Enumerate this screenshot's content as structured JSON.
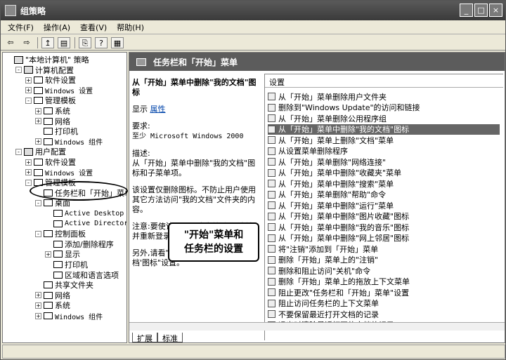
{
  "window": {
    "title": "组策略",
    "buttons": [
      "_",
      "□",
      "×"
    ]
  },
  "menu": [
    "文件(F)",
    "操作(A)",
    "查看(V)",
    "帮助(H)"
  ],
  "toolbar": [
    "⇦",
    "⇨",
    "↥",
    "▤",
    "⎘",
    "?",
    "▦"
  ],
  "tree": [
    {
      "label": "\"本地计算机\" 策略",
      "depth": 0,
      "exp": "",
      "icon": "comp"
    },
    {
      "label": "计算机配置",
      "depth": 1,
      "exp": "-",
      "icon": "comp"
    },
    {
      "label": "软件设置",
      "depth": 2,
      "exp": "+",
      "icon": "fold"
    },
    {
      "label": "Windows 设置",
      "depth": 2,
      "exp": "+",
      "icon": "fold",
      "mono": true
    },
    {
      "label": "管理模板",
      "depth": 2,
      "exp": "-",
      "icon": "fold"
    },
    {
      "label": "系统",
      "depth": 3,
      "exp": "+",
      "icon": "fold"
    },
    {
      "label": "网络",
      "depth": 3,
      "exp": "+",
      "icon": "fold"
    },
    {
      "label": "打印机",
      "depth": 3,
      "exp": "",
      "icon": "fold"
    },
    {
      "label": "Windows 组件",
      "depth": 3,
      "exp": "+",
      "icon": "fold",
      "mono": true
    },
    {
      "label": "用户配置",
      "depth": 1,
      "exp": "-",
      "icon": "comp"
    },
    {
      "label": "软件设置",
      "depth": 2,
      "exp": "+",
      "icon": "fold"
    },
    {
      "label": "Windows 设置",
      "depth": 2,
      "exp": "+",
      "icon": "fold",
      "mono": true
    },
    {
      "label": "管理模板",
      "depth": 2,
      "exp": "-",
      "icon": "fold"
    },
    {
      "label": "任务栏和「开始」菜单",
      "depth": 3,
      "exp": "",
      "icon": "fold"
    },
    {
      "label": "桌面",
      "depth": 3,
      "exp": "-",
      "icon": "fold"
    },
    {
      "label": "Active Desktop",
      "depth": 4,
      "exp": "",
      "icon": "fold",
      "mono": true
    },
    {
      "label": "Active Directory",
      "depth": 4,
      "exp": "",
      "icon": "fold",
      "mono": true
    },
    {
      "label": "控制面板",
      "depth": 3,
      "exp": "-",
      "icon": "fold"
    },
    {
      "label": "添加/删除程序",
      "depth": 4,
      "exp": "",
      "icon": "fold"
    },
    {
      "label": "显示",
      "depth": 4,
      "exp": "+",
      "icon": "fold"
    },
    {
      "label": "打印机",
      "depth": 4,
      "exp": "",
      "icon": "fold"
    },
    {
      "label": "区域和语言选项",
      "depth": 4,
      "exp": "",
      "icon": "fold"
    },
    {
      "label": "共享文件夹",
      "depth": 3,
      "exp": "",
      "icon": "fold"
    },
    {
      "label": "网络",
      "depth": 3,
      "exp": "+",
      "icon": "fold"
    },
    {
      "label": "系统",
      "depth": 3,
      "exp": "+",
      "icon": "fold"
    },
    {
      "label": "Windows 组件",
      "depth": 3,
      "exp": "+",
      "icon": "fold",
      "mono": true
    }
  ],
  "right": {
    "header": "任务栏和「开始」菜单",
    "desc_title": "从「开始」菜单中删除\"我的文档\"图标",
    "show_label": "显示",
    "show_link": "属性",
    "req_label": "要求:",
    "req_text": "至少 Microsoft Windows 2000",
    "desc_label": "描述:",
    "desc_text": "从「开始」菜单中删除\"我的文档\"图标和子菜单项。",
    "desc_text2": "该设置仅删除图标。不防止用户使用其它方法访问\"我的文档\"文件夹的内容。",
    "note_text": "注意:要使该设置更改生效,必须注销并重新登录。",
    "more_text": "另外,请看\"删除桌面上的'我的文档'图标\"设置。",
    "list_header": "设置",
    "rows": [
      "从「开始」菜单删除用户文件夹",
      "删除到\"Windows Update\"的访问和链接",
      "从「开始」菜单删除公用程序组",
      "从「开始」菜单中删除\"我的文档\"图标",
      "从「开始」菜单上删除\"文档\"菜单",
      "从设置菜单删除程序",
      "从「开始」菜单删除\"网络连接\"",
      "从「开始」菜单中删除\"收藏夹\"菜单",
      "从「开始」菜单中删除\"搜索\"菜单",
      "从「开始」菜单删除\"帮助\"命令",
      "从「开始」菜单中删除\"运行\"菜单",
      "从「开始」菜单中删除\"图片收藏\"图标",
      "从「开始」菜单中删除\"我的音乐\"图标",
      "从「开始」菜单中删除\"网上邻居\"图标",
      "将\"注销\"添加到「开始」菜单",
      "删除「开始」菜单上的\"注销\"",
      "删除和阻止访问\"关机\"命令",
      "删除「开始」菜单上的拖放上下文菜单",
      "阻止更改\"任务栏和「开始」菜单\"设置",
      "阻止访问任务栏的上下文菜单",
      "不要保留最近打开文档的记录",
      "退出时清除最近打开的文档的记录"
    ],
    "selected_index": 3,
    "tabs": [
      "扩展",
      "标准"
    ]
  },
  "callout": {
    "line1": "\"开始\"菜单和",
    "line2": "任务栏的设置"
  }
}
